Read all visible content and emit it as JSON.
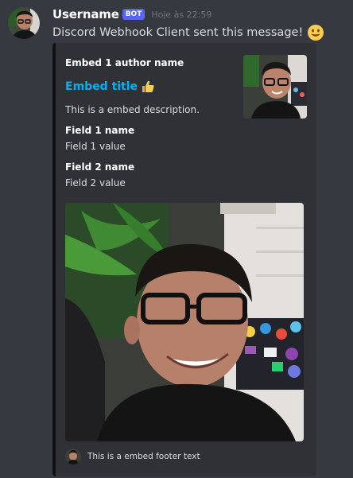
{
  "message": {
    "username": "Username",
    "bot_tag": "BOT",
    "timestamp": "Hoje às 22:59",
    "content": "Discord Webhook Client sent this message!",
    "content_emoji": "smiley-emoji"
  },
  "embed": {
    "author_name": "Embed 1 author name",
    "title": "Embed title",
    "title_emoji": "thumbs-up-emoji",
    "description": "This is a embed description.",
    "fields": [
      {
        "name": "Field 1 name",
        "value": "Field 1 value"
      },
      {
        "name": "Field 2 name",
        "value": "Field 2 value"
      }
    ],
    "footer_text": "This is a embed footer text"
  },
  "colors": {
    "background": "#36393f",
    "embed_background": "#2f3136",
    "embed_border": "#0f1012",
    "bot_tag": "#5865f2",
    "title_link": "#00b0f4"
  }
}
